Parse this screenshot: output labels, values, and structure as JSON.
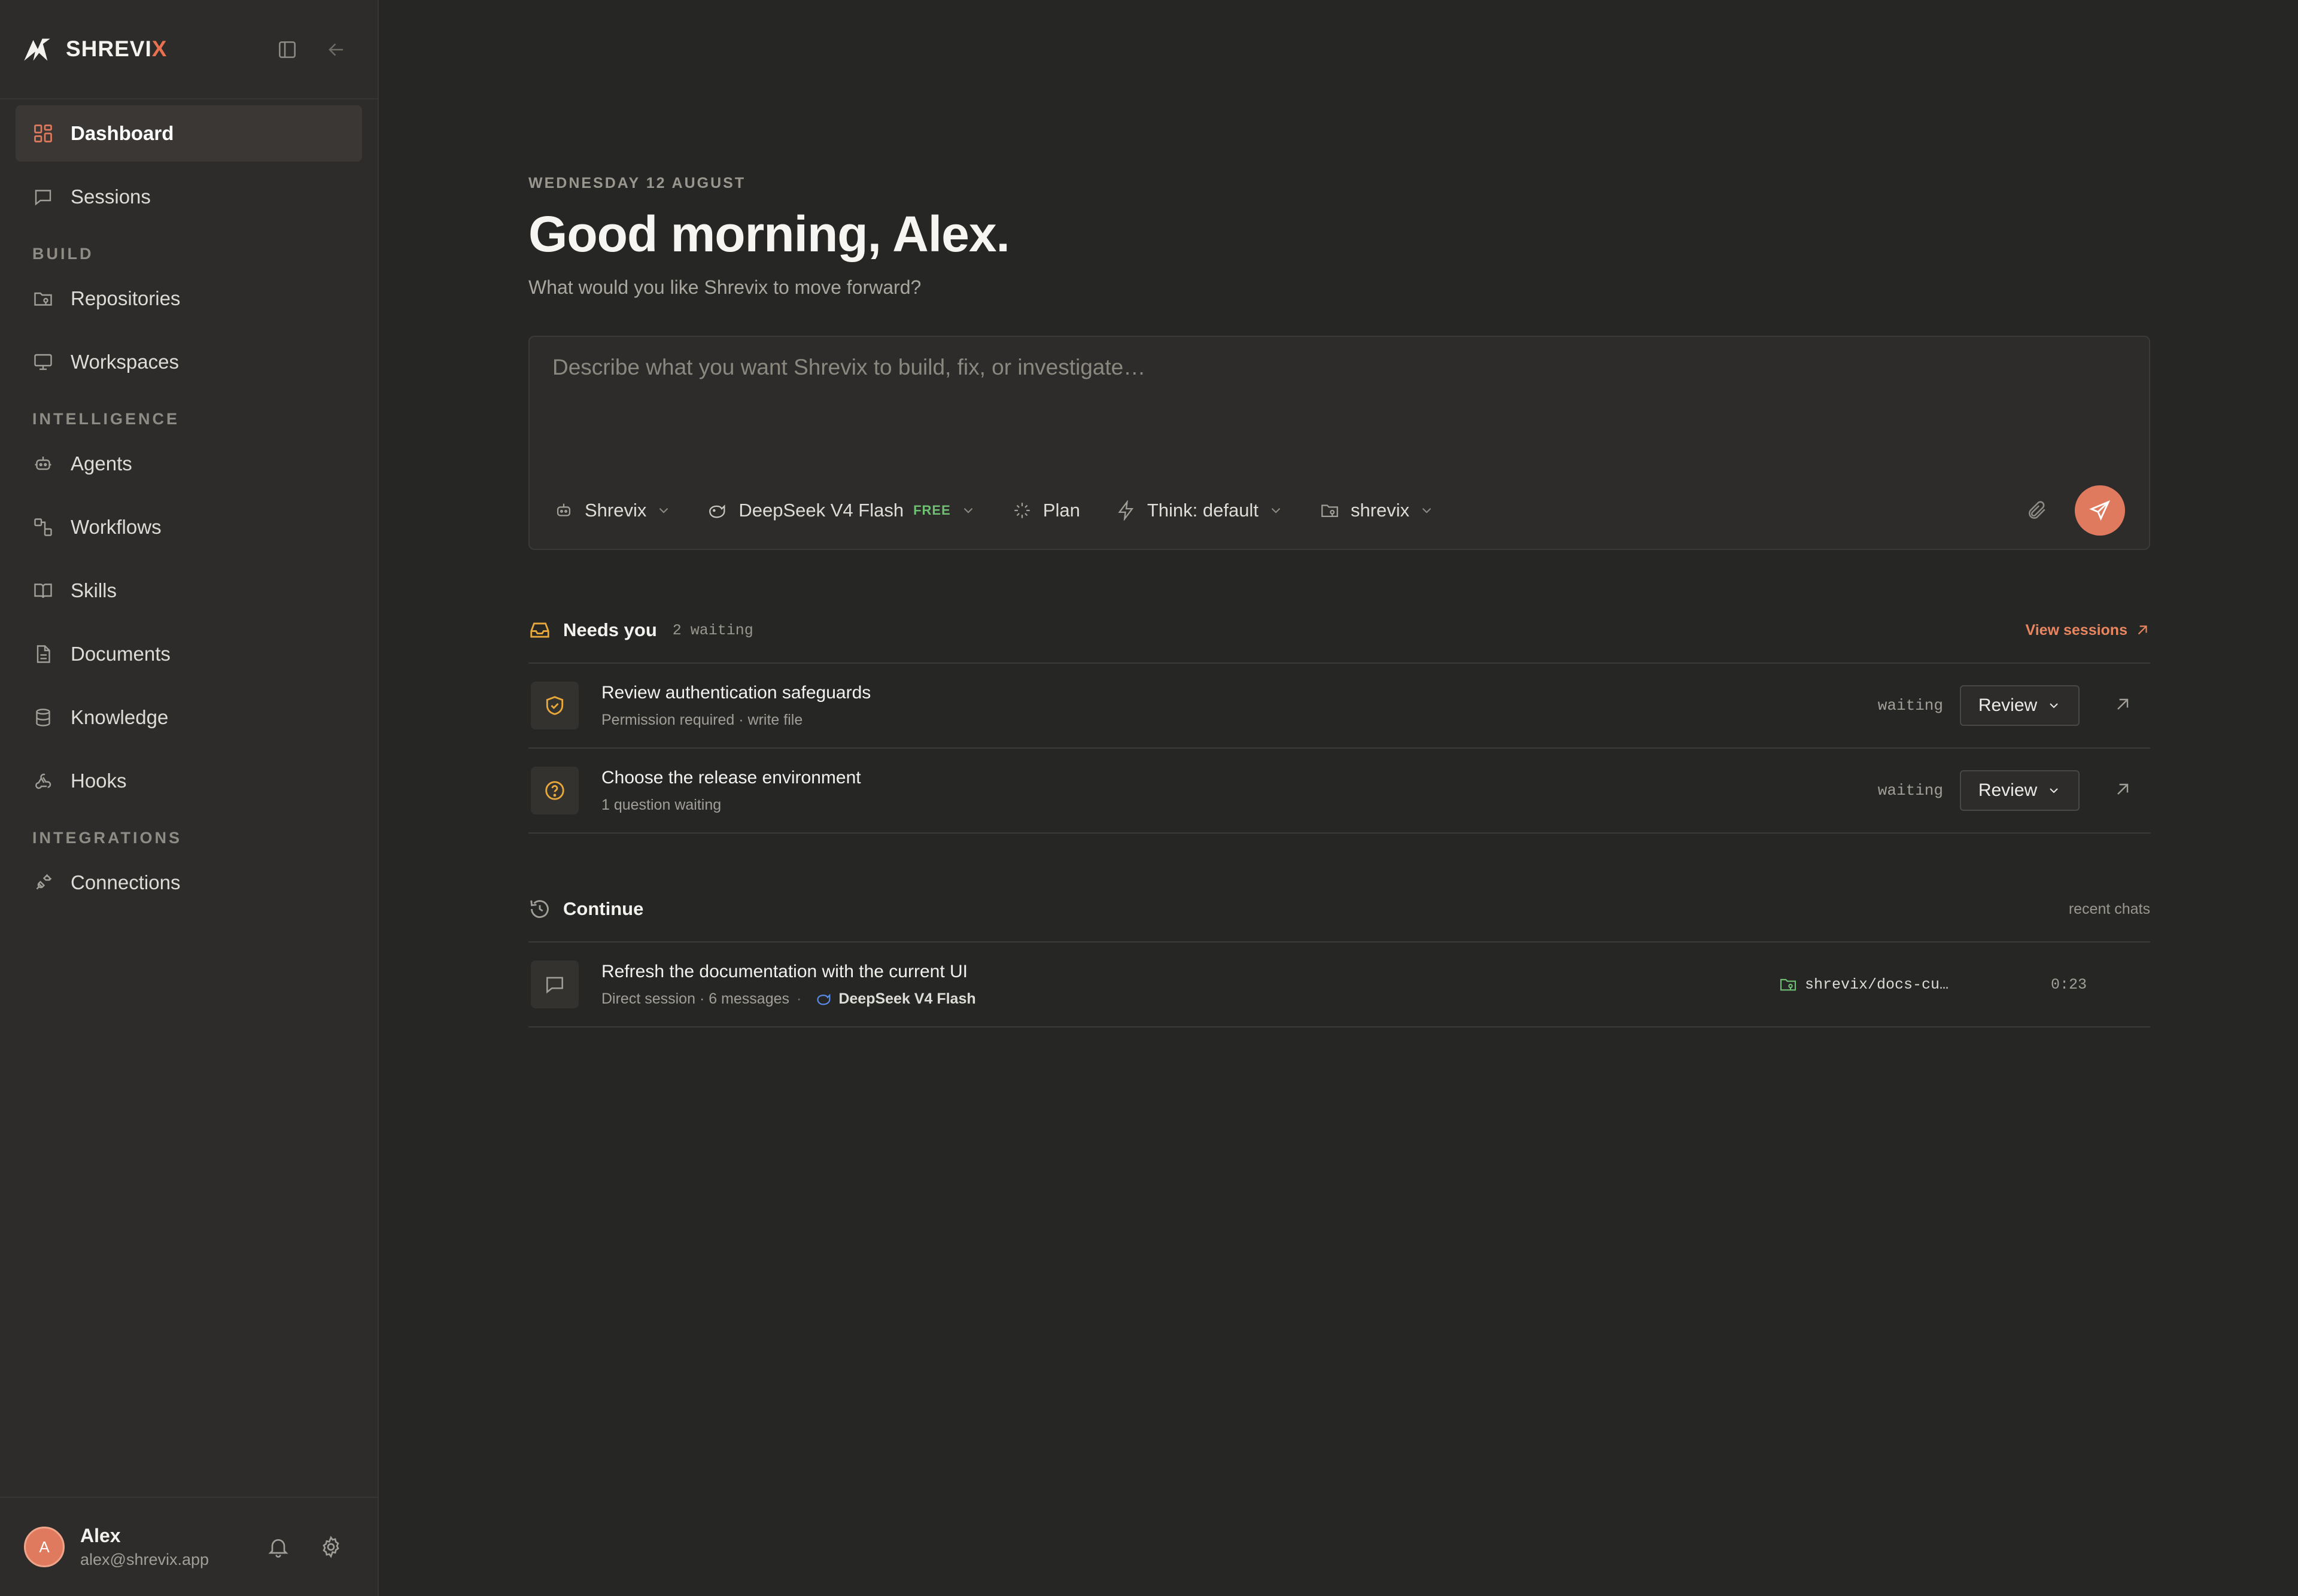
{
  "brand": {
    "name_main": "SHREVI",
    "name_accent": "X"
  },
  "sidebar": {
    "items_top": [
      {
        "label": "Dashboard",
        "icon": "dashboard-icon",
        "active": true
      },
      {
        "label": "Sessions",
        "icon": "chat-icon"
      }
    ],
    "section_build": "BUILD",
    "items_build": [
      {
        "label": "Repositories",
        "icon": "repo-icon"
      },
      {
        "label": "Workspaces",
        "icon": "monitor-icon"
      }
    ],
    "section_intelligence": "INTELLIGENCE",
    "items_intelligence": [
      {
        "label": "Agents",
        "icon": "bot-icon"
      },
      {
        "label": "Workflows",
        "icon": "workflow-icon"
      },
      {
        "label": "Skills",
        "icon": "book-icon"
      },
      {
        "label": "Documents",
        "icon": "document-icon"
      },
      {
        "label": "Knowledge",
        "icon": "database-icon"
      },
      {
        "label": "Hooks",
        "icon": "webhook-icon"
      }
    ],
    "section_integrations": "INTEGRATIONS",
    "items_integrations": [
      {
        "label": "Connections",
        "icon": "plug-icon"
      }
    ]
  },
  "user": {
    "initial": "A",
    "name": "Alex",
    "email": "alex@shrevix.app"
  },
  "main": {
    "date": "WEDNESDAY 12 AUGUST",
    "greeting": "Good morning, Alex.",
    "subtitle": "What would you like Shrevix to move forward?",
    "composer": {
      "placeholder": "Describe what you want Shrevix to build, fix, or investigate…",
      "agent": "Shrevix",
      "model": "DeepSeek V4 Flash",
      "model_badge": "FREE",
      "mode": "Plan",
      "think": "Think: default",
      "repo": "shrevix"
    },
    "needs": {
      "title": "Needs you",
      "count": "2 waiting",
      "link": "View sessions",
      "rows": [
        {
          "title": "Review authentication safeguards",
          "sub": "Permission required · write file",
          "status": "waiting",
          "action": "Review",
          "icon": "shield-check-icon"
        },
        {
          "title": "Choose the release environment",
          "sub": "1 question waiting",
          "status": "waiting",
          "action": "Review",
          "icon": "question-icon"
        }
      ]
    },
    "continue": {
      "title": "Continue",
      "note": "recent chats",
      "rows": [
        {
          "title": "Refresh the documentation with the current UI",
          "sub": "Direct session · 6 messages",
          "model": "DeepSeek V4 Flash",
          "repo": "shrevix/docs-cu…",
          "duration": "0:23"
        }
      ]
    }
  },
  "colors": {
    "accent": "#e07a5f",
    "free": "#6fbf73",
    "warning": "#e8a93a"
  }
}
